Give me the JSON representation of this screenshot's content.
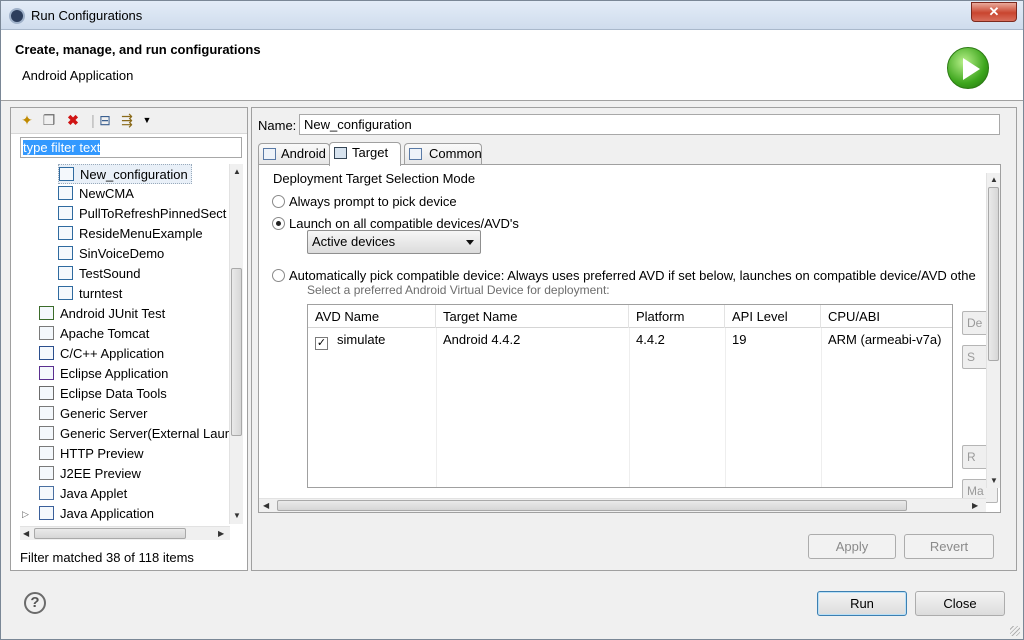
{
  "window": {
    "title": "Run Configurations",
    "close_glyph": "✕"
  },
  "banner": {
    "title": "Create, manage, and run configurations",
    "subtitle": "Android Application"
  },
  "left": {
    "filter_text": "type filter text",
    "tree": [
      {
        "label": "New_configuration",
        "indent": 2,
        "selected": true,
        "icon": "android-config-icon"
      },
      {
        "label": "NewCMA",
        "indent": 2,
        "icon": "android-config-icon"
      },
      {
        "label": "PullToRefreshPinnedSect",
        "indent": 2,
        "icon": "android-config-icon"
      },
      {
        "label": "ResideMenuExample",
        "indent": 2,
        "icon": "android-config-icon"
      },
      {
        "label": "SinVoiceDemo",
        "indent": 2,
        "icon": "android-config-icon"
      },
      {
        "label": "TestSound",
        "indent": 2,
        "icon": "android-config-icon"
      },
      {
        "label": "turntest",
        "indent": 2,
        "icon": "android-config-icon"
      },
      {
        "label": "Android JUnit Test",
        "indent": 1,
        "icon": "junit-icon"
      },
      {
        "label": "Apache Tomcat",
        "indent": 1,
        "icon": "server-icon"
      },
      {
        "label": "C/C++ Application",
        "indent": 1,
        "icon": "cpp-icon"
      },
      {
        "label": "Eclipse Application",
        "indent": 1,
        "icon": "eclipse-icon"
      },
      {
        "label": "Eclipse Data Tools",
        "indent": 1,
        "icon": "database-icon"
      },
      {
        "label": "Generic Server",
        "indent": 1,
        "icon": "server-icon"
      },
      {
        "label": "Generic Server(External Laun",
        "indent": 1,
        "icon": "server-icon"
      },
      {
        "label": "HTTP Preview",
        "indent": 1,
        "icon": "server-icon"
      },
      {
        "label": "J2EE Preview",
        "indent": 1,
        "icon": "server-icon"
      },
      {
        "label": "Java Applet",
        "indent": 1,
        "icon": "applet-icon"
      },
      {
        "label": "Java Application",
        "indent": 1,
        "icon": "java-app-icon",
        "expandable": true
      }
    ],
    "status": "Filter matched 38 of 118 items"
  },
  "right": {
    "name_label": "Name:",
    "name_value": "New_configuration",
    "tabs": [
      {
        "label": "Android",
        "active": false
      },
      {
        "label": "Target",
        "active": true
      },
      {
        "label": "Common",
        "active": false
      }
    ],
    "group_title": "Deployment Target Selection Mode",
    "radio_prompt": "Always prompt to pick device",
    "radio_launch_all": "Launch on all compatible devices/AVD's",
    "combo_value": "Active devices",
    "radio_auto": "Automatically pick compatible device: Always uses preferred AVD if set below, launches on compatible device/AVD othe",
    "hint": "Select a preferred Android Virtual Device for deployment:",
    "avd_columns": [
      "AVD Name",
      "Target Name",
      "Platform",
      "API Level",
      "CPU/ABI"
    ],
    "avd_rows": [
      {
        "checked": true,
        "name": "simulate",
        "target": "Android 4.4.2",
        "platform": "4.4.2",
        "api": "19",
        "cpu": "ARM (armeabi-v7a)"
      }
    ],
    "side_buttons": [
      "De",
      "S",
      "R",
      "Ma"
    ]
  },
  "buttons": {
    "apply": "Apply",
    "revert": "Revert",
    "run": "Run",
    "close": "Close",
    "help": "?"
  },
  "colors": {
    "selection": "#3399ff",
    "run_green": "#3da61d",
    "close_red": "#c9452f"
  }
}
